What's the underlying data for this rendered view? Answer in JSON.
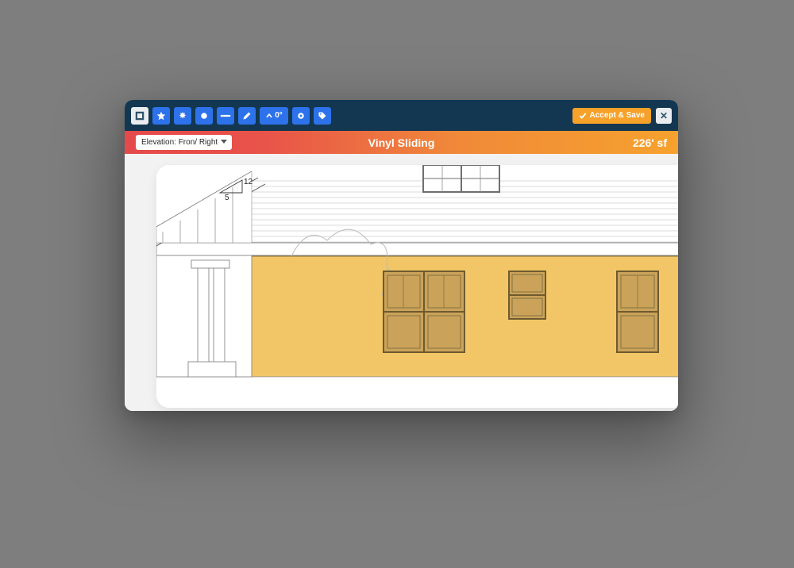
{
  "toolbar": {
    "tools": [
      {
        "name": "select-tool",
        "icon": "crop"
      },
      {
        "name": "star-tool",
        "icon": "star"
      },
      {
        "name": "burst-tool",
        "icon": "burst"
      },
      {
        "name": "circle-tool",
        "icon": "circle"
      },
      {
        "name": "line-tool",
        "icon": "line"
      },
      {
        "name": "pencil-tool",
        "icon": "pencil"
      },
      {
        "name": "angle-tool",
        "icon": "angle",
        "label": "0°"
      },
      {
        "name": "gear-tool",
        "icon": "gear"
      },
      {
        "name": "tag-tool",
        "icon": "tag"
      }
    ],
    "accept_label": "Accept & Save",
    "close_label": "✕"
  },
  "info_bar": {
    "elevation_select": "Elevation: Fron/ Right",
    "title": "Vinyl Sliding",
    "area": "226' sf"
  },
  "drawing": {
    "pitch_label": "12",
    "rise_label": "5"
  }
}
